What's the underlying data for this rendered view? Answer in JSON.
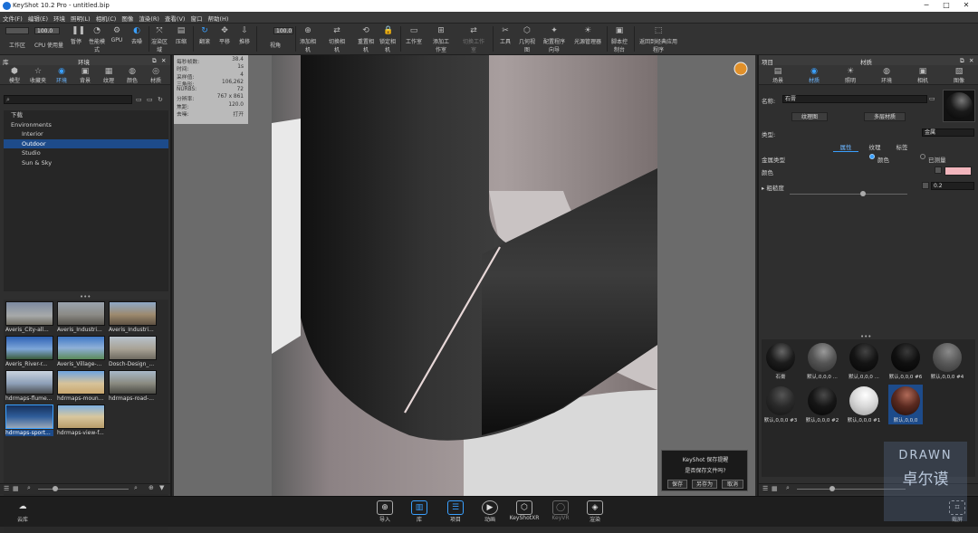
{
  "window": {
    "title": "KeyShot 10.2 Pro  - untitled.bip",
    "minimize": "─",
    "maximize": "□",
    "close": "✕"
  },
  "menu": [
    "文件(F)",
    "编辑(E)",
    "环境",
    "照明(L)",
    "相机(C)",
    "图像",
    "渲染(R)",
    "查看(V)",
    "窗口",
    "帮助(H)"
  ],
  "toolbar": {
    "workspace_label": "工作区",
    "cpu_value": "100.0",
    "cpu_label": "CPU 使用量",
    "pause_label": "暂停",
    "perf_label": "性能模式",
    "gpu_label": "GPU",
    "denoise_label": "去噪",
    "region_label": "渲染区域",
    "tumble_label": "翻滚",
    "pan_label": "平移",
    "dolly_label": "推移",
    "fov_value": "100.0",
    "fov_label": "视角",
    "add_camera_label": "添加相机",
    "switch_camera_label": "切换相机",
    "reset_camera_label": "重置相机",
    "lock_camera_label": "锁定相机",
    "studio_label": "工作室",
    "add_studio_label": "添加工作室",
    "switch_studio_label": "切换工作室",
    "tools_label": "工具",
    "geometry_label": "几何视图",
    "configurator_label": "配置程序向导",
    "light_manager_label": "光源管理器",
    "script_label": "脚本控制台",
    "back_label": "返回到经典应用程序"
  },
  "library": {
    "header_left": "库",
    "header_title": "环境",
    "tabs": [
      "模型",
      "收藏夹",
      "环境",
      "背景",
      "纹理",
      "颜色",
      "材质"
    ],
    "active_tab": "环境",
    "tree": [
      {
        "label": "下载",
        "indent": 0
      },
      {
        "label": "Environments",
        "indent": 0
      },
      {
        "label": "Interior",
        "indent": 1
      },
      {
        "label": "Outdoor",
        "indent": 1,
        "selected": true
      },
      {
        "label": "Studio",
        "indent": 1
      },
      {
        "label": "Sun & Sky",
        "indent": 1
      }
    ],
    "thumbnails": [
      {
        "label": "Averis_City-all...",
        "color": "#7c8aa0"
      },
      {
        "label": "Averis_Industri...",
        "color": "#8c8b86"
      },
      {
        "label": "Averis_Industri...",
        "color": "#9d8a6e"
      },
      {
        "label": "Averis_River-r...",
        "color": "#3d6fb8"
      },
      {
        "label": "Averis_Village-...",
        "color": "#5b8b5a"
      },
      {
        "label": "Dosch-Design_...",
        "color": "#a8a295"
      },
      {
        "label": "hdrmaps-flume...",
        "color": "#8ea0b8"
      },
      {
        "label": "hdrmaps-moun...",
        "color": "#c8a66e"
      },
      {
        "label": "hdrmaps-road-...",
        "color": "#8a8a80"
      },
      {
        "label": "hdrmaps-sport...",
        "color": "#2f5d9a",
        "selected": true
      },
      {
        "label": "hdrmaps-view-f...",
        "color": "#b89c6a"
      }
    ]
  },
  "stats": [
    {
      "k": "每秒帧数:",
      "v": "38.4"
    },
    {
      "k": "时间:",
      "v": "1s"
    },
    {
      "k": "采样值:",
      "v": "4"
    },
    {
      "k": "三角形:",
      "v": "106,262"
    },
    {
      "k": "NURBS:",
      "v": "72"
    },
    {
      "k": "分辨率:",
      "v": "767 x 861"
    },
    {
      "k": "焦距:",
      "v": "120.0"
    },
    {
      "k": "去噪:",
      "v": "打开"
    }
  ],
  "save_popup": {
    "title": "KeyShot 保存提醒",
    "message": "是否保存文件吗?",
    "save": "保存",
    "save_as": "另存为",
    "cancel": "取消"
  },
  "project": {
    "header_left": "项目",
    "header_title": "材质",
    "tabs": [
      "场景",
      "材质",
      "照明",
      "环境",
      "相机",
      "图像"
    ],
    "active_tab": "材质",
    "name_label": "名称:",
    "name_value": "石膏",
    "btn_texture": "纹理图",
    "btn_multi": "多层材质",
    "type_label": "类型:",
    "type_value": "金属",
    "subtabs": [
      "属性",
      "纹理",
      "标签"
    ],
    "active_subtab": "属性",
    "metal_type_label": "金属类型",
    "color_option": "颜色",
    "measured_option": "已测量",
    "color_label": "颜色",
    "color_value": "#f2b6bd",
    "roughness_label": "粗糙度",
    "roughness_value": "0.2",
    "roughness_fraction": 0.62,
    "materials": [
      {
        "label": "石膏",
        "color": "#1c1c1c"
      },
      {
        "label": "默认,0,0,0 ...",
        "color": "#555555"
      },
      {
        "label": "默认,0,0,0 ...",
        "color": "#141414"
      },
      {
        "label": "默认,0,0,0 #6",
        "color": "#101010"
      },
      {
        "label": "默认,0,0,0 #4",
        "color": "#5a5a5a"
      },
      {
        "label": "默认,0,0,0 #3",
        "color": "#2a2a2a"
      },
      {
        "label": "默认,0,0,0 #2",
        "color": "#161616"
      },
      {
        "label": "默认,0,0,0 #1",
        "color": "#d8d8d8"
      },
      {
        "label": "默认,0,0,0",
        "color": "#5a2a20",
        "selected": true
      }
    ]
  },
  "bottom_bar": {
    "cloud_label": "云库",
    "import_label": "导入",
    "library_label": "库",
    "project_label": "项目",
    "animation_label": "动画",
    "keyshotxr_label": "KeyShotXR",
    "keyvr_label": "KeyVR",
    "render_label": "渲染",
    "screenshot_label": "截屏"
  },
  "watermark": {
    "line1": "DRAWN",
    "line2": "卓尔谟"
  }
}
